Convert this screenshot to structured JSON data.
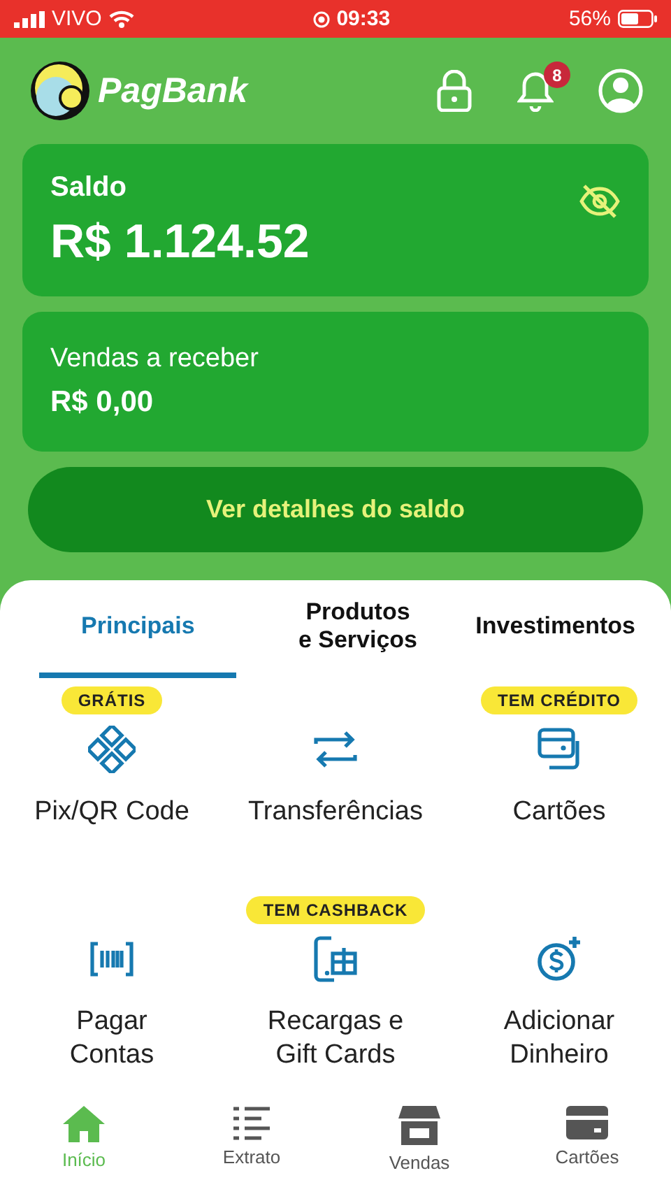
{
  "status_bar": {
    "carrier": "VIVO",
    "time": "09:33",
    "battery": "56%"
  },
  "header": {
    "brand": "PagBank",
    "notifications": "8"
  },
  "balance": {
    "label": "Saldo",
    "amount": "R$ 1.124.52"
  },
  "receivables": {
    "label": "Vendas a receber",
    "amount": "R$ 0,00"
  },
  "details_button": "Ver detalhes do saldo",
  "tabs": [
    {
      "label": "Principais",
      "selected": true
    },
    {
      "label": "Produtos\ne Serviços",
      "selected": false
    },
    {
      "label": "Investimentos",
      "selected": false
    }
  ],
  "actions": [
    {
      "label": "Pix/QR Code",
      "badge": "GRÁTIS"
    },
    {
      "label": "Transferências"
    },
    {
      "label": "Cartões",
      "badge": "TEM CRÉDITO"
    },
    {
      "label": "Pagar\nContas"
    },
    {
      "label": "Recargas e\nGift Cards",
      "badge": "TEM CASHBACK"
    },
    {
      "label": "Adicionar\nDinheiro"
    }
  ],
  "bottom_nav": [
    {
      "label": "Início",
      "selected": true
    },
    {
      "label": "Extrato",
      "selected": false
    },
    {
      "label": "Vendas",
      "selected": false
    },
    {
      "label": "Cartões",
      "selected": false
    }
  ]
}
